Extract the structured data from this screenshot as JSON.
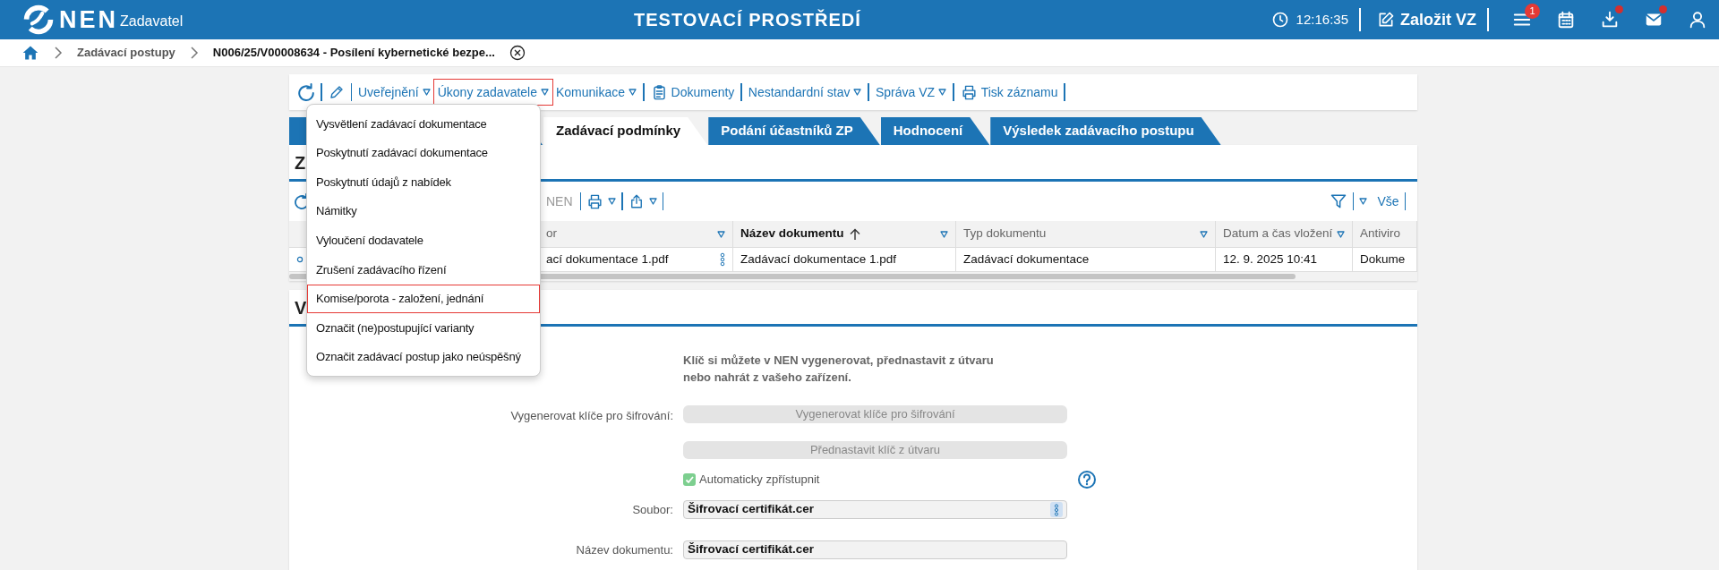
{
  "header": {
    "brand": "NEN",
    "app": "Zadavatel",
    "environment": "TESTOVACÍ PROSTŘEDÍ",
    "clock": "12:16:35",
    "create_button": "Založit VZ",
    "icons": [
      {
        "kind": "menu",
        "badge": "1",
        "dot": false
      },
      {
        "kind": "calendar",
        "dot": false
      },
      {
        "kind": "download",
        "dot": true
      },
      {
        "kind": "mail",
        "dot": true
      },
      {
        "kind": "user",
        "dot": false
      }
    ]
  },
  "breadcrumb": [
    {
      "label": "Zadávací postupy",
      "current": false
    },
    {
      "label": "N006/25/V00008634 - Posílení kybernetické bezpe...",
      "current": true
    }
  ],
  "toolbar": [
    {
      "kind": "refresh"
    },
    {
      "kind": "edit"
    },
    {
      "kind": "dropdown",
      "label": "Uveřejnění",
      "expanded": false
    },
    {
      "kind": "dropdown",
      "label": "Úkony zadavatele",
      "expanded": true
    },
    {
      "kind": "dropdown",
      "label": "Komunikace",
      "expanded": false
    },
    {
      "kind": "documents",
      "label": "Dokumenty"
    },
    {
      "kind": "dropdown",
      "label": "Nestandardní stav",
      "expanded": false
    },
    {
      "kind": "dropdown",
      "label": "Správa VZ",
      "expanded": false
    },
    {
      "kind": "print",
      "label": "Tisk záznamu"
    }
  ],
  "menu": {
    "items": [
      {
        "label": "Vysvětlení zadávací dokumentace",
        "selected": false
      },
      {
        "label": "Poskytnutí zadávací dokumentace",
        "selected": false
      },
      {
        "label": "Poskytnutí údajů z nabídek",
        "selected": false
      },
      {
        "label": "Námitky",
        "selected": false
      },
      {
        "label": "Vyloučení dodavatele",
        "selected": false
      },
      {
        "label": "Zrušení zadávacího řízení",
        "selected": false
      },
      {
        "label": "Komise/porota - založení, jednání",
        "selected": true
      },
      {
        "label": "Označit (ne)postupující varianty",
        "selected": false
      },
      {
        "label": "Označit zadávací postup jako neúspěšný",
        "selected": false
      }
    ]
  },
  "tabs": [
    {
      "selected": false
    },
    {
      "label": "Zadávací podmínky",
      "selected": true
    },
    {
      "label": "Podání účastníků ZP",
      "selected": false
    },
    {
      "label": "Hodnocení",
      "selected": false
    },
    {
      "label": "Výsledek zadávacího postupu",
      "selected": false
    }
  ],
  "documents": {
    "title": "Z",
    "action": "NEN",
    "filter": "Vše",
    "columns": [
      {
        "label": "or",
        "filter": true,
        "sorted": false
      },
      {
        "label": "Název dokumentu",
        "filter": true,
        "sorted": true
      },
      {
        "label": "Typ dokumentu",
        "filter": true,
        "sorted": false
      },
      {
        "label": "Datum a čas vložení",
        "filter": true,
        "sorted": false
      },
      {
        "label": "Antiviro",
        "filter": false,
        "sorted": false
      }
    ],
    "rows": [
      {
        "cells": [
          "ací dokumentace 1.pdf",
          "Zadávací dokumentace 1.pdf",
          "Zadávací dokumentace",
          "12. 9. 2025 10:41",
          "Dokume"
        ]
      }
    ]
  },
  "encryption": {
    "title": "V",
    "fields": [
      {
        "kind": "note",
        "text": "Klíč si můžete v NEN vygenerovat, přednastavit z útvaru nebo nahrát z vašeho zařízení."
      },
      {
        "kind": "button",
        "label": "Vygenerovat klíče pro šifrování:",
        "text": "Vygenerovat klíče pro šifrování",
        "disabled": true
      },
      {
        "kind": "button",
        "text": "Přednastavit klíč z útvaru",
        "disabled": true
      },
      {
        "kind": "checkbox",
        "text": "Automaticky zpřístupnit",
        "checked": true
      },
      {
        "kind": "file",
        "label": "Soubor:",
        "value": "Šifrovací certifikát.cer"
      },
      {
        "kind": "text",
        "label": "Název dokumentu:",
        "value": "Šifrovací certifikát.cer"
      }
    ]
  }
}
